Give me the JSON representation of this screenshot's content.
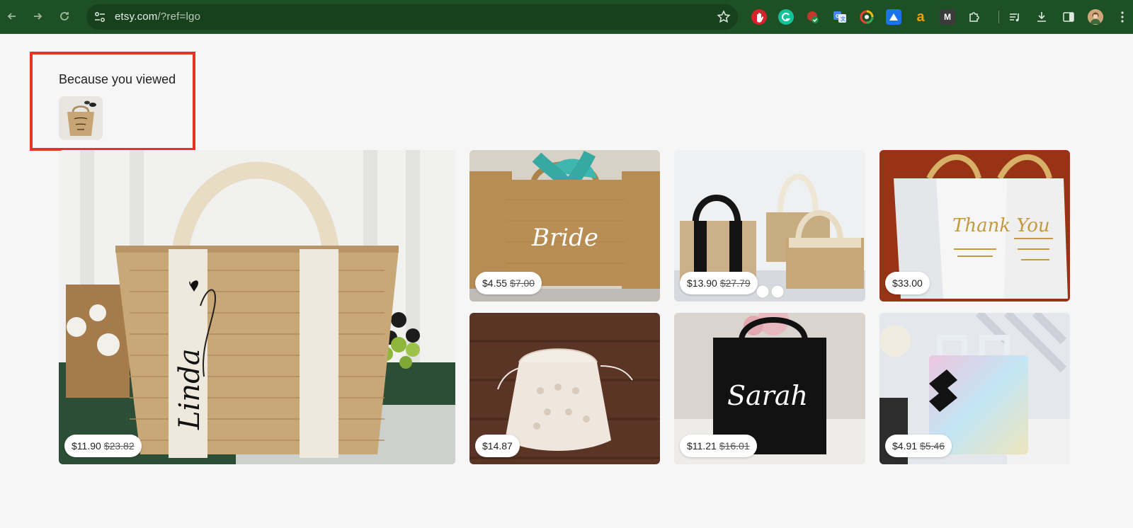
{
  "browser": {
    "url_domain": "etsy.com",
    "url_path": "/?ref=lgo",
    "toolbar_icons": [
      "back-icon",
      "forward-icon",
      "reload-icon",
      "site-settings-icon",
      "bookmark-star-icon"
    ],
    "extensions": [
      "hand-extension-icon",
      "grammarly-icon",
      "check-extension-icon",
      "google-translate-icon",
      "color-picker-icon",
      "drive-icon",
      "amazon-icon",
      "m-extension-icon",
      "puzzle-icon",
      "reading-list-icon",
      "download-icon",
      "side-panel-icon",
      "profile-avatar"
    ],
    "amazon_letter": "a",
    "m_letter": "M"
  },
  "section": {
    "title": "Because you viewed"
  },
  "products": [
    {
      "price": "$11.90",
      "old_price": "$23.82",
      "art_text": "Linda"
    },
    {
      "price": "$4.55",
      "old_price": "$7.00",
      "art_text": "Bride"
    },
    {
      "price": "$13.90",
      "old_price": "$27.79"
    },
    {
      "price": "$33.00",
      "old_price": "",
      "art_text": "Thank You"
    },
    {
      "price": "$14.87",
      "old_price": ""
    },
    {
      "price": "$11.21",
      "old_price": "$16.01",
      "art_text": "Sarah"
    },
    {
      "price": "$4.91",
      "old_price": "$5.46"
    }
  ],
  "colors": {
    "chrome_bg": "#1e5026",
    "highlight": "#e63323",
    "page_bg": "#f6f6f6"
  }
}
